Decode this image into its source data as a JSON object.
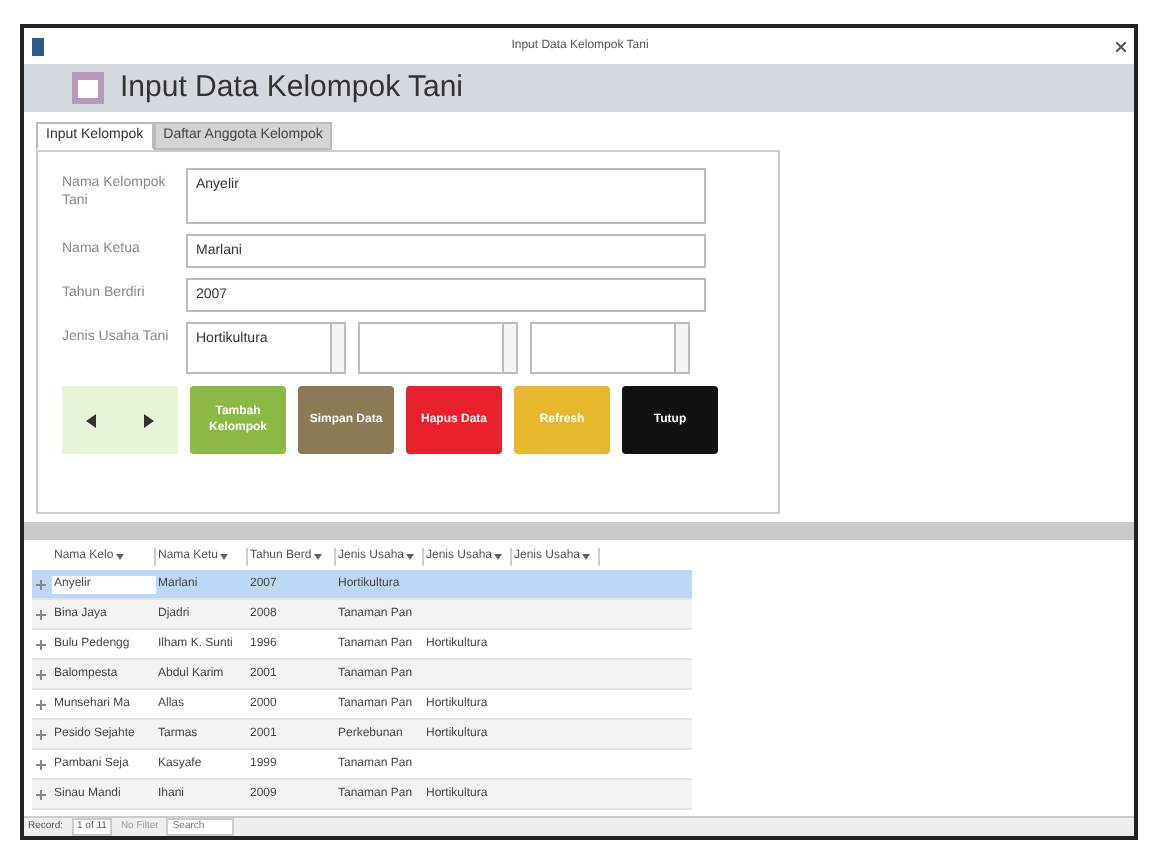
{
  "window": {
    "title": "Input Data Kelompok Tani"
  },
  "header": {
    "title": "Input Data Kelompok Tani"
  },
  "tabs": [
    {
      "label": "Input Kelompok",
      "selected": true
    },
    {
      "label": "Daftar Anggota Kelompok",
      "selected": false
    }
  ],
  "form": {
    "fields": [
      {
        "label": "Nama Kelompok Tani",
        "value": "Anyelir",
        "kind": "text"
      },
      {
        "label": "Nama Ketua",
        "value": "Marlani",
        "kind": "text"
      },
      {
        "label": "Tahun Berdiri",
        "value": "2007",
        "kind": "text"
      },
      {
        "label": "Jenis Usaha Tani",
        "values": [
          "Hortikultura"
        ],
        "kind": "list"
      }
    ]
  },
  "buttons": [
    {
      "label": "Tambah Kelompok",
      "color": "#8cb844"
    },
    {
      "label": "Simpan Data",
      "color": "#8a7a55"
    },
    {
      "label": "Hapus Data",
      "color": "#e8202a"
    },
    {
      "label": "Refresh",
      "color": "#e6b82e"
    },
    {
      "label": "Tutup",
      "color": "#111111"
    }
  ],
  "table": {
    "columns": [
      "Nama Kelo",
      "Nama Ketu",
      "Tahun Berd",
      "Jenis Usaha",
      "Jenis Usaha",
      "Jenis Usaha"
    ],
    "rows": [
      {
        "selected": true,
        "cells": [
          "Anyelir",
          "Marlani",
          "2007",
          "Hortikultura",
          "",
          ""
        ]
      },
      {
        "selected": false,
        "cells": [
          "Bina Jaya",
          "Djadri",
          "2008",
          "Tanaman Pan",
          "",
          ""
        ]
      },
      {
        "selected": false,
        "cells": [
          "Bulu Pedengg",
          "Ilham K. Sunti",
          "1996",
          "Tanaman Pan",
          "Hortikultura",
          ""
        ]
      },
      {
        "selected": false,
        "cells": [
          "Balompesta",
          "Abdul Karim",
          "2001",
          "Tanaman Pan",
          "",
          ""
        ]
      },
      {
        "selected": false,
        "cells": [
          "Munsehari Ma",
          "Allas",
          "2000",
          "Tanaman Pan",
          "Hortikultura",
          ""
        ]
      },
      {
        "selected": false,
        "cells": [
          "Pesido Sejahte",
          "Tarmas",
          "2001",
          "Perkebunan",
          "Hortikultura",
          ""
        ]
      },
      {
        "selected": false,
        "cells": [
          "Pambani Seja",
          "Kasyafe",
          "1999",
          "Tanaman Pan",
          "",
          ""
        ]
      },
      {
        "selected": false,
        "cells": [
          "Sinau Mandi",
          "Ihani",
          "2009",
          "Tanaman Pan",
          "Hortikultura",
          ""
        ]
      }
    ]
  },
  "status_bar": {
    "record_label": "Record:",
    "position": "1 of 11",
    "filter": "No Filter",
    "search_placeholder": "Search"
  }
}
